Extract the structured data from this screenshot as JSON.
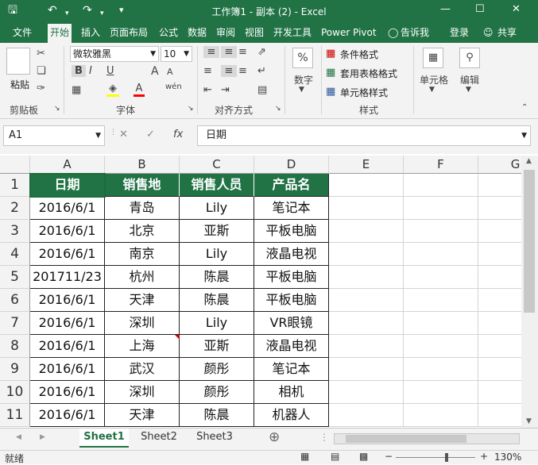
{
  "window": {
    "title": "工作簿1 - 副本 (2)  -  Excel",
    "min_glyph": "—",
    "max_glyph": "☐",
    "close_glyph": "✕",
    "save_glyph": "🖫",
    "undo_glyph": "↶",
    "redo_glyph": "↷",
    "customize_glyph": "▾"
  },
  "menu": {
    "items": [
      "文件",
      "开始",
      "插入",
      "页面布局",
      "公式",
      "数据",
      "审阅",
      "视图",
      "开发工具",
      "Power Pivot"
    ],
    "active_index": 1,
    "tell_me": "告诉我",
    "login": "登录",
    "share": "共享"
  },
  "ribbon": {
    "paste_label": "粘贴",
    "font_name": "微软雅黑",
    "font_size": "10",
    "number_label": "数字",
    "number_icon": "%",
    "conditional_format": "条件格式",
    "table_format": "套用表格格式",
    "cell_style": "单元格样式",
    "cells_label": "单元格",
    "edit_label": "编辑",
    "groups": {
      "clipboard": "剪贴板",
      "font": "字体",
      "alignment": "对齐方式",
      "styles": "样式"
    },
    "bold": "B",
    "italic": "I",
    "underline": "U",
    "font_color_letter": "A",
    "grow_font": "A",
    "shrink_font": "A",
    "wen": "wén"
  },
  "formula_bar": {
    "name_box": "A1",
    "cancel": "✕",
    "confirm": "✓",
    "fx": "fx",
    "content": "日期"
  },
  "sheet": {
    "columns": [
      "A",
      "B",
      "C",
      "D",
      "E",
      "F",
      "G"
    ],
    "rows": [
      "1",
      "2",
      "3",
      "4",
      "5",
      "6",
      "7",
      "8",
      "9",
      "10",
      "11"
    ],
    "header": [
      "日期",
      "销售地",
      "销售人员",
      "产品名"
    ],
    "data": [
      [
        "2016/6/1",
        "青岛",
        "Lily",
        "笔记本"
      ],
      [
        "2016/6/1",
        "北京",
        "亚斯",
        "平板电脑"
      ],
      [
        "2016/6/1",
        "南京",
        "Lily",
        "液晶电视"
      ],
      [
        "201711/23",
        "杭州",
        "陈晨",
        "平板电脑"
      ],
      [
        "2016/6/1",
        "天津",
        "陈晨",
        "平板电脑"
      ],
      [
        "2016/6/1",
        "深圳",
        "Lily",
        "VR眼镜"
      ],
      [
        "2016/6/1",
        "上海",
        "亚斯",
        "液晶电视"
      ],
      [
        "2016/6/1",
        "武汉",
        "颜彤",
        "笔记本"
      ],
      [
        "2016/6/1",
        "深圳",
        "颜彤",
        "相机"
      ],
      [
        "2016/6/1",
        "天津",
        "陈晨",
        "机器人"
      ]
    ]
  },
  "tabs": {
    "sheets": [
      "Sheet1",
      "Sheet2",
      "Sheet3"
    ],
    "active_index": 0,
    "add_glyph": "⊕"
  },
  "status": {
    "text": "就绪",
    "zoom": "130%",
    "minus": "−",
    "plus": "+"
  },
  "colors": {
    "accent": "#217346",
    "header_fill": "#217346"
  }
}
